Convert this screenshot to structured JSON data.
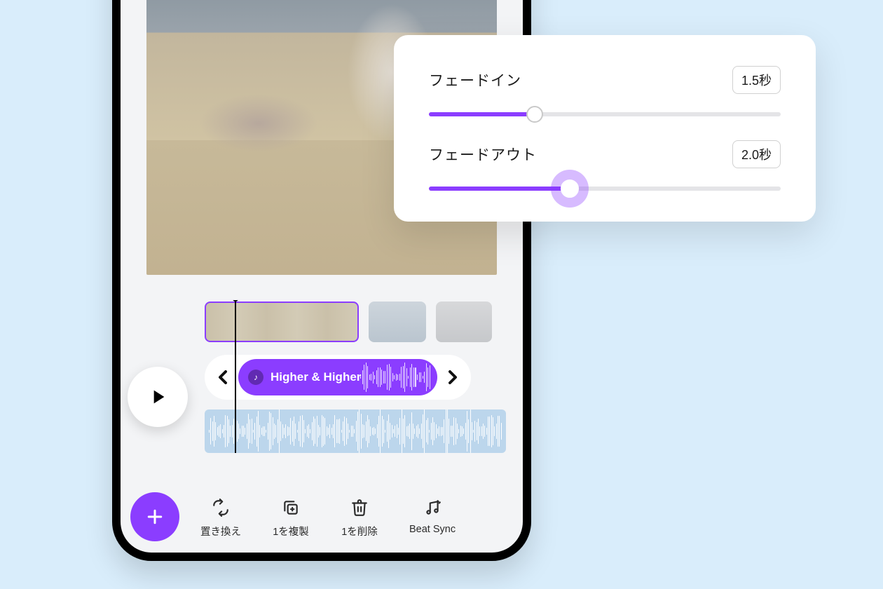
{
  "colors": {
    "accent": "#8b3dff",
    "background": "#d9edfb"
  },
  "popover": {
    "fade_in": {
      "label": "フェードイン",
      "value": "1.5秒",
      "percent": 30
    },
    "fade_out": {
      "label": "フェードアウト",
      "value": "2.0秒",
      "percent": 40,
      "active": true
    }
  },
  "audio": {
    "track_title": "Higher & Higher",
    "icon": "music-note-icon"
  },
  "toolbar": {
    "replace": {
      "label": "置き換え"
    },
    "duplicate": {
      "label": "1を複製"
    },
    "delete": {
      "label": "1を削除"
    },
    "beat_sync": {
      "label": "Beat Sync"
    }
  }
}
